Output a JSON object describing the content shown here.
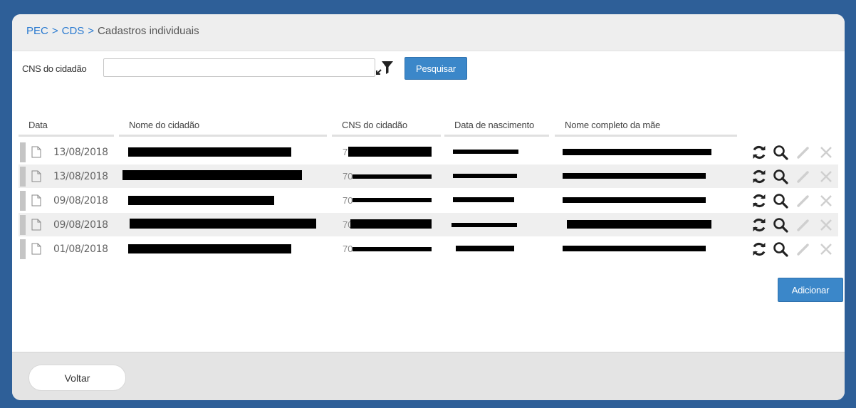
{
  "breadcrumb": {
    "item1": "PEC",
    "item2": "CDS",
    "current": "Cadastros individuais",
    "separator": ">"
  },
  "search": {
    "label": "CNS do cidadão",
    "value": "",
    "placeholder": "",
    "button_label": "Pesquisar"
  },
  "table": {
    "columns": [
      "Data",
      "Nome do cidadão",
      "CNS do cidadão",
      "Data de nascimento",
      "Nome completo da mãe"
    ],
    "rows": [
      {
        "date": "13/08/2018",
        "cns_visible": "7"
      },
      {
        "date": "13/08/2018",
        "cns_visible": "70"
      },
      {
        "date": "09/08/2018",
        "cns_visible": "70"
      },
      {
        "date": "09/08/2018",
        "cns_visible": "70"
      },
      {
        "date": "01/08/2018",
        "cns_visible": "70"
      }
    ]
  },
  "icons": {
    "sync": "sync-icon",
    "view": "magnifier-icon",
    "edit": "pencil-icon",
    "delete": "close-icon",
    "filter": "filter-icon",
    "document": "document-icon"
  },
  "colors": {
    "frame": "#2e5f98",
    "primary_button": "#3b87c9",
    "link": "#2a7ad0"
  },
  "add_button_label": "Adicionar",
  "back_button_label": "Voltar"
}
